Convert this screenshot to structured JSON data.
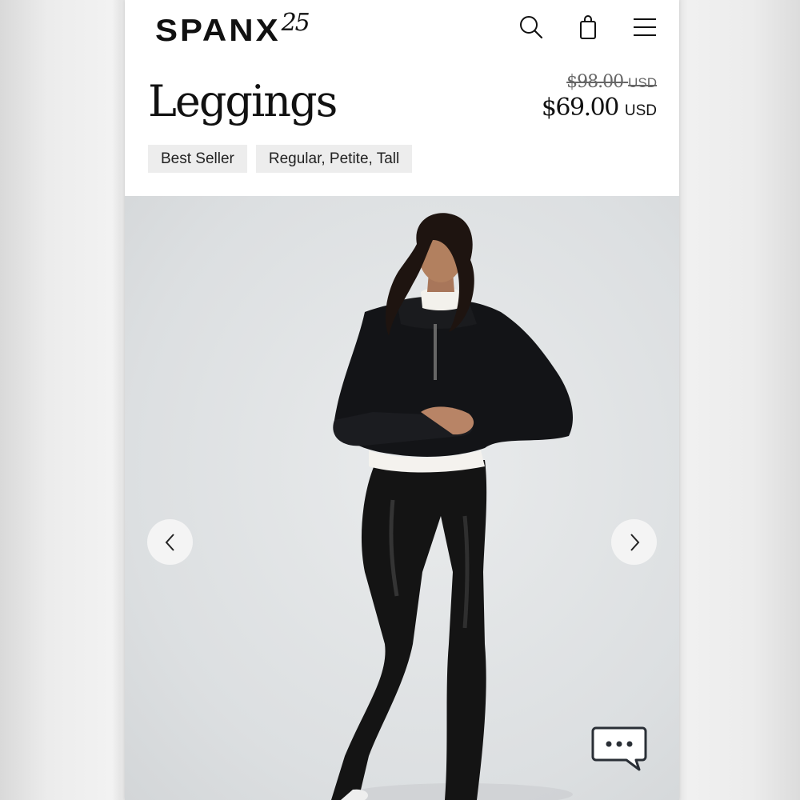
{
  "header": {
    "logo_text": "SPANX",
    "logo_badge": "25",
    "icons": [
      "search-icon",
      "shopping-bag-icon",
      "menu-icon"
    ]
  },
  "product": {
    "title": "Leggings",
    "price_original": "$98.00",
    "price_original_currency": "USD",
    "price_sale": "$69.00",
    "price_sale_currency": "USD",
    "tags": [
      "Best Seller",
      "Regular, Petite, Tall"
    ]
  },
  "gallery": {
    "image_description": "Model wearing black faux leather leggings with a black half-zip sweatshirt",
    "prev_icon": "chevron-left-icon",
    "next_icon": "chevron-right-icon"
  },
  "chat": {
    "icon": "chat-bubble-icon"
  },
  "colors": {
    "text": "#111111",
    "tag_bg": "#ededed",
    "gallery_bg": "#dcdfe1"
  }
}
